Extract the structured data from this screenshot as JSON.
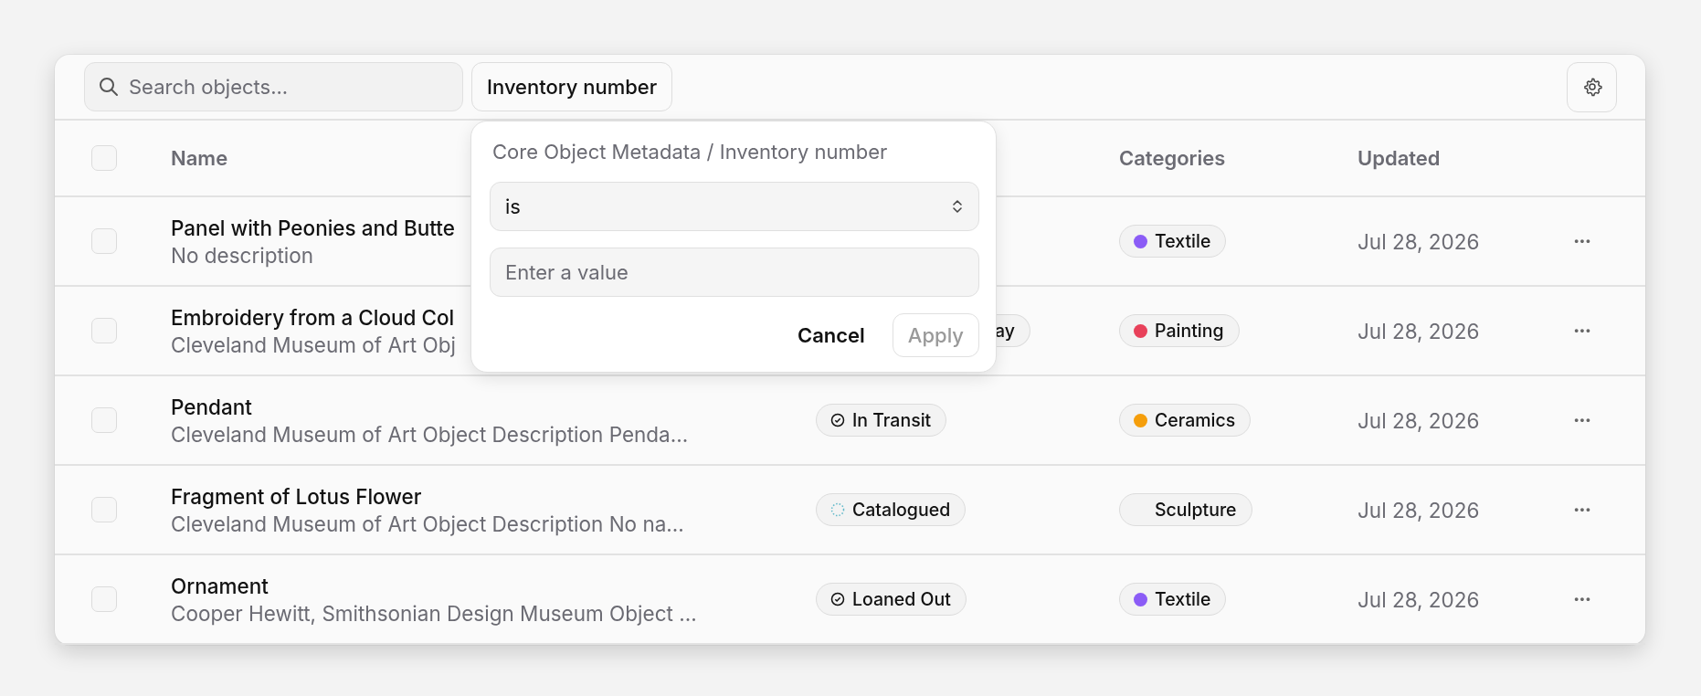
{
  "toolbar": {
    "search": {
      "placeholder": "Search objects..."
    },
    "filter_button": "Inventory number"
  },
  "table": {
    "select_all": {
      "checked": false
    },
    "columns": [
      {
        "label": "Name"
      },
      {},
      {
        "label": "Categories"
      },
      {
        "label": "Updated"
      }
    ],
    "rows": [
      {
        "checked": false,
        "name": "Panel with Peonies and Butte",
        "description": "No description",
        "categories": [
          {
            "label": "Textile",
            "color": "#8b5cf6"
          }
        ],
        "updated": "Jul 28, 2026",
        "more": "···"
      },
      {
        "checked": false,
        "name": "Embroidery from a Cloud Col",
        "description": "Cleveland Museum of Art Obj",
        "status": {
          "label": "ay",
          "kind": "partial"
        },
        "categories": [
          {
            "label": "Painting",
            "color": "#e8415a"
          }
        ],
        "updated": "Jul 28, 2026",
        "more": "···"
      },
      {
        "checked": false,
        "name": "Pendant",
        "description": "Cleveland Museum of Art Object Description Penda...",
        "status": {
          "label": "In Transit",
          "kind": "check"
        },
        "categories": [
          {
            "label": "Ceramics",
            "color": "#f59e0b"
          }
        ],
        "updated": "Jul 28, 2026",
        "more": "···"
      },
      {
        "checked": false,
        "name": "Fragment of Lotus Flower",
        "description": "Cleveland Museum of Art Object Description No na...",
        "status": {
          "label": "Catalogued",
          "kind": "pending"
        },
        "categories": [
          {
            "label": "Sculpture"
          }
        ],
        "updated": "Jul 28, 2026",
        "more": "···"
      },
      {
        "checked": false,
        "name": "Ornament",
        "description": "Cooper Hewitt, Smithsonian Design Museum Object ...",
        "status": {
          "label": "Loaned Out",
          "kind": "check"
        },
        "categories": [
          {
            "label": "Textile",
            "color": "#8b5cf6"
          }
        ],
        "updated": "Jul 28, 2026",
        "more": "···"
      }
    ]
  },
  "popover": {
    "title": "Core Object Metadata / Inventory number",
    "operator": "is",
    "value_placeholder": "Enter a value",
    "cancel": "Cancel",
    "apply": "Apply"
  }
}
